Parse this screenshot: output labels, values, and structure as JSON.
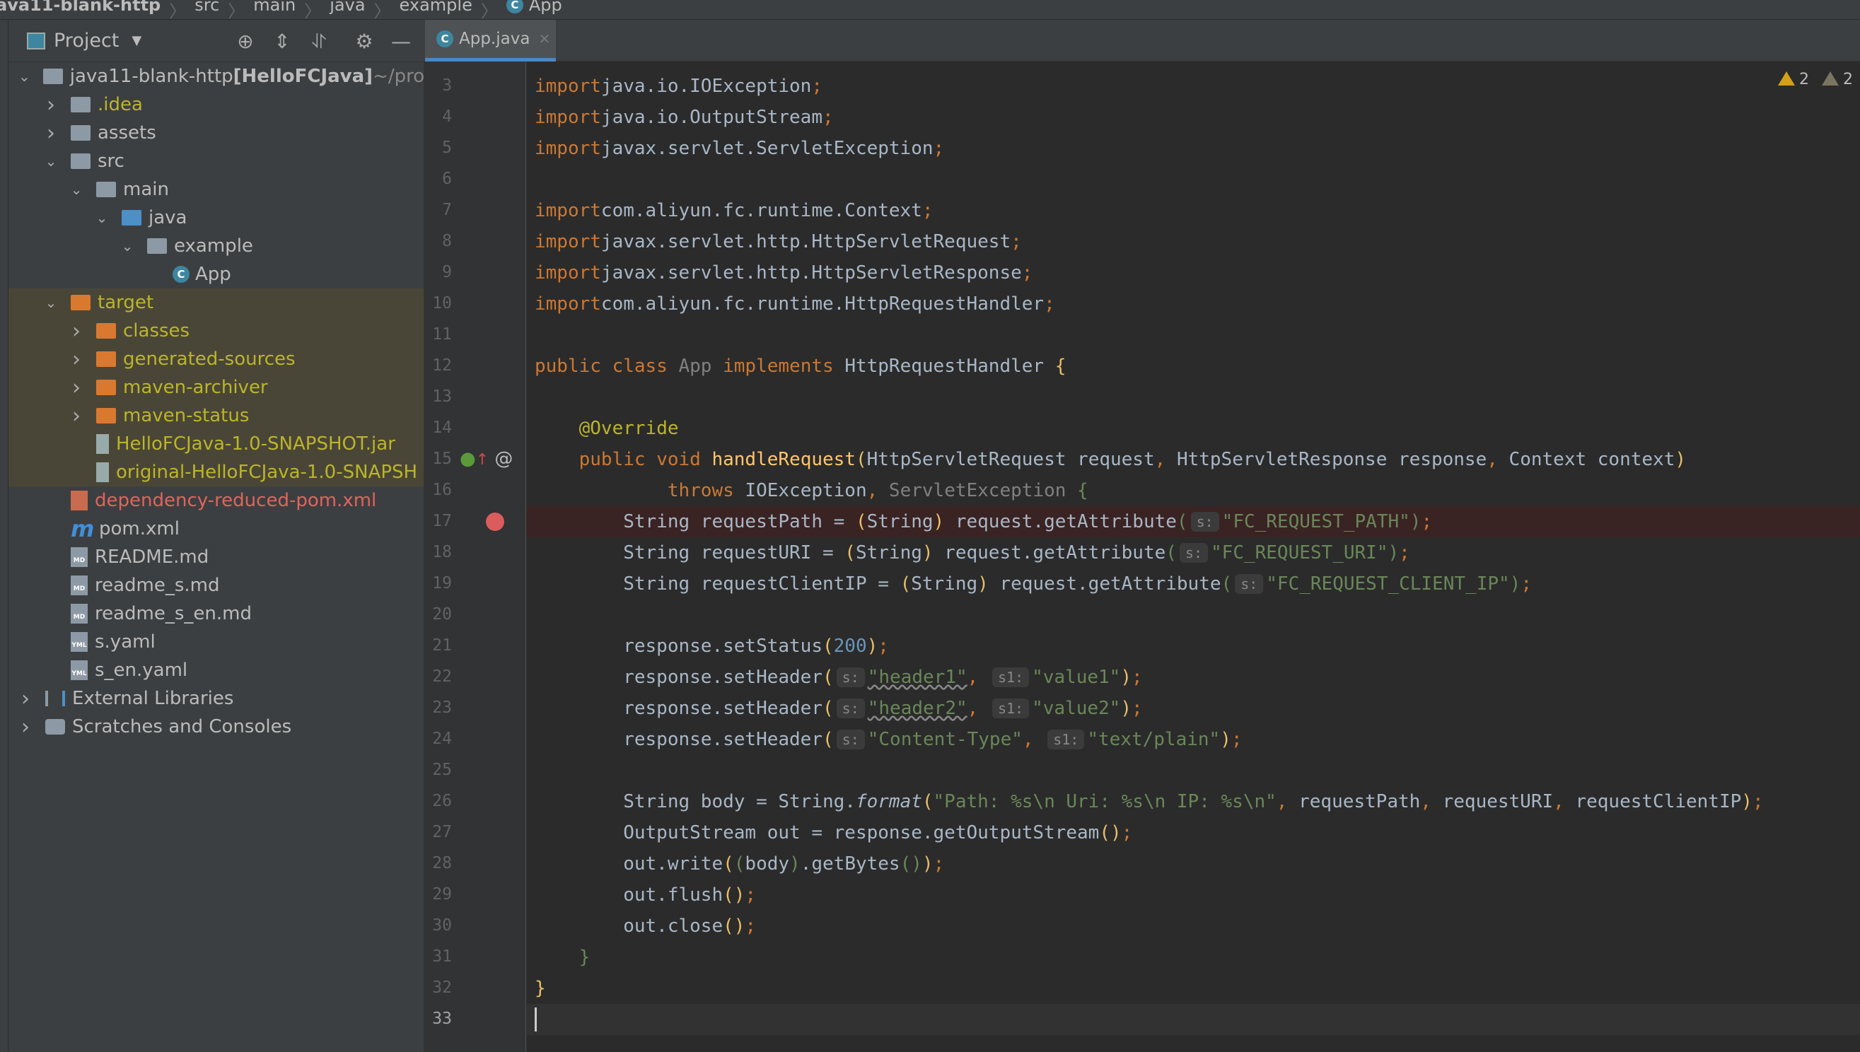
{
  "breadcrumb": [
    "ava11-blank-http",
    "src",
    "main",
    "java",
    "example",
    "App"
  ],
  "project_panel": {
    "title": "Project",
    "toolbar_icons": [
      "locate-icon",
      "expand-all-icon",
      "collapse-all-icon",
      "gear-icon",
      "minimize-icon"
    ]
  },
  "tree": [
    {
      "depth": 0,
      "arrow": "down",
      "icon": "module",
      "label": "java11-blank-http ",
      "bold": "[HelloFCJava]",
      "suffix": " ~/proje"
    },
    {
      "depth": 1,
      "arrow": "right",
      "icon": "folder",
      "label": ".idea",
      "color": "yellow"
    },
    {
      "depth": 1,
      "arrow": "right",
      "icon": "folder",
      "label": "assets"
    },
    {
      "depth": 1,
      "arrow": "down",
      "icon": "folder",
      "label": "src"
    },
    {
      "depth": 2,
      "arrow": "down",
      "icon": "folder",
      "label": "main"
    },
    {
      "depth": 3,
      "arrow": "down",
      "icon": "folder-blue",
      "label": "java"
    },
    {
      "depth": 4,
      "arrow": "down",
      "icon": "package",
      "label": "example"
    },
    {
      "depth": 5,
      "arrow": "",
      "icon": "class",
      "label": "App"
    },
    {
      "depth": 1,
      "arrow": "down",
      "icon": "folder-orange",
      "label": "target",
      "color": "yellow",
      "excluded": true
    },
    {
      "depth": 2,
      "arrow": "right",
      "icon": "folder-orange",
      "label": "classes",
      "color": "yellow",
      "excluded": true
    },
    {
      "depth": 2,
      "arrow": "right",
      "icon": "folder-orange",
      "label": "generated-sources",
      "color": "yellow",
      "excluded": true
    },
    {
      "depth": 2,
      "arrow": "right",
      "icon": "folder-orange",
      "label": "maven-archiver",
      "color": "yellow",
      "excluded": true
    },
    {
      "depth": 2,
      "arrow": "right",
      "icon": "folder-orange",
      "label": "maven-status",
      "color": "yellow",
      "excluded": true
    },
    {
      "depth": 2,
      "arrow": "",
      "icon": "jar",
      "label": "HelloFCJava-1.0-SNAPSHOT.jar",
      "color": "yellow",
      "excluded": true
    },
    {
      "depth": 2,
      "arrow": "",
      "icon": "jar",
      "label": "original-HelloFCJava-1.0-SNAPSH",
      "color": "yellow",
      "excluded": true
    },
    {
      "depth": 1,
      "arrow": "",
      "icon": "xml",
      "label": "dependency-reduced-pom.xml",
      "color": "red"
    },
    {
      "depth": 1,
      "arrow": "",
      "icon": "maven",
      "label": "pom.xml"
    },
    {
      "depth": 1,
      "arrow": "",
      "icon": "md",
      "label": "README.md"
    },
    {
      "depth": 1,
      "arrow": "",
      "icon": "md",
      "label": "readme_s.md"
    },
    {
      "depth": 1,
      "arrow": "",
      "icon": "md",
      "label": "readme_s_en.md"
    },
    {
      "depth": 1,
      "arrow": "",
      "icon": "yaml",
      "label": "s.yaml"
    },
    {
      "depth": 1,
      "arrow": "",
      "icon": "yaml",
      "label": "s_en.yaml"
    },
    {
      "depth": 0,
      "arrow": "right",
      "icon": "libraries",
      "label": "External Libraries"
    },
    {
      "depth": 0,
      "arrow": "right",
      "icon": "scratches",
      "label": "Scratches and Consoles"
    }
  ],
  "editor": {
    "tab": "App.java",
    "warnings": [
      {
        "count": "2",
        "kind": "warning"
      },
      {
        "count": "2",
        "kind": "weak-warning"
      }
    ],
    "breakpoint_line": 17,
    "current_line": 33,
    "lines": [
      {
        "n": "3",
        "t": [
          [
            "kw",
            "import"
          ],
          [
            "",
            "java.io.IOException"
          ],
          [
            "kw",
            ";"
          ]
        ]
      },
      {
        "n": "4",
        "t": [
          [
            "kw",
            "import"
          ],
          [
            "",
            "java.io.OutputStream"
          ],
          [
            "kw",
            ";"
          ]
        ]
      },
      {
        "n": "5",
        "t": [
          [
            "kw",
            "import"
          ],
          [
            "",
            "javax.servlet.ServletException"
          ],
          [
            "kw",
            ";"
          ]
        ]
      },
      {
        "n": "6",
        "t": []
      },
      {
        "n": "7",
        "t": [
          [
            "kw",
            "import"
          ],
          [
            "",
            "com.aliyun.fc.runtime.Context"
          ],
          [
            "kw",
            ";"
          ]
        ]
      },
      {
        "n": "8",
        "t": [
          [
            "kw",
            "import"
          ],
          [
            "",
            "javax.servlet.http.HttpServletRequest"
          ],
          [
            "kw",
            ";"
          ]
        ]
      },
      {
        "n": "9",
        "t": [
          [
            "kw",
            "import"
          ],
          [
            "",
            "javax.servlet.http.HttpServletResponse"
          ],
          [
            "kw",
            ";"
          ]
        ]
      },
      {
        "n": "10",
        "t": [
          [
            "kw",
            "import"
          ],
          [
            "",
            "com.aliyun.fc.runtime.HttpRequestHandler"
          ],
          [
            "kw",
            ";"
          ]
        ]
      },
      {
        "n": "11",
        "t": []
      },
      {
        "n": "12",
        "t": [
          [
            "kw",
            "public class "
          ],
          [
            "gr",
            "App "
          ],
          [
            "kw",
            "implements "
          ],
          [
            "",
            "HttpRequestHandler "
          ],
          [
            "br",
            "{"
          ]
        ]
      },
      {
        "n": "13",
        "t": []
      },
      {
        "n": "14",
        "t": [
          [
            "",
            "    "
          ],
          [
            "an",
            "@Override"
          ]
        ]
      },
      {
        "n": "15",
        "t": [
          [
            "",
            "    "
          ],
          [
            "kw",
            "public void "
          ],
          [
            "fn",
            "handleRequest"
          ],
          [
            "br",
            "("
          ],
          [
            "",
            "HttpServletRequest request"
          ],
          [
            "kw",
            ", "
          ],
          [
            "",
            "HttpServletResponse response"
          ],
          [
            "kw",
            ", "
          ],
          [
            "",
            "Context context"
          ],
          [
            "br",
            ")"
          ]
        ]
      },
      {
        "n": "16",
        "t": [
          [
            "",
            "            "
          ],
          [
            "kw",
            "throws "
          ],
          [
            "",
            "IOException"
          ],
          [
            "kw",
            ", "
          ],
          [
            "gr",
            "ServletException "
          ],
          [
            "st",
            "{"
          ]
        ]
      },
      {
        "n": "17",
        "t": [
          [
            "",
            "        String requestPath = "
          ],
          [
            "br",
            "("
          ],
          [
            "",
            "String"
          ],
          [
            "br",
            ")"
          ],
          [
            "",
            " request.getAttribute"
          ],
          [
            "st",
            "("
          ],
          [
            "hint",
            "s:"
          ],
          [
            "st",
            "\"FC_REQUEST_PATH\""
          ],
          [
            "st",
            ")"
          ],
          [
            "kw",
            ";"
          ]
        ]
      },
      {
        "n": "18",
        "t": [
          [
            "",
            "        String requestURI = "
          ],
          [
            "br",
            "("
          ],
          [
            "",
            "String"
          ],
          [
            "br",
            ")"
          ],
          [
            "",
            " request.getAttribute"
          ],
          [
            "st",
            "("
          ],
          [
            "hint",
            "s:"
          ],
          [
            "st",
            "\"FC_REQUEST_URI\""
          ],
          [
            "st",
            ")"
          ],
          [
            "kw",
            ";"
          ]
        ]
      },
      {
        "n": "19",
        "t": [
          [
            "",
            "        String requestClientIP = "
          ],
          [
            "br",
            "("
          ],
          [
            "",
            "String"
          ],
          [
            "br",
            ")"
          ],
          [
            "",
            " request.getAttribute"
          ],
          [
            "st",
            "("
          ],
          [
            "hint",
            "s:"
          ],
          [
            "st",
            "\"FC_REQUEST_CLIENT_IP\""
          ],
          [
            "st",
            ")"
          ],
          [
            "kw",
            ";"
          ]
        ]
      },
      {
        "n": "20",
        "t": []
      },
      {
        "n": "21",
        "t": [
          [
            "",
            "        response.setStatus"
          ],
          [
            "br",
            "("
          ],
          [
            "num",
            "200"
          ],
          [
            "br",
            ")"
          ],
          [
            "kw",
            ";"
          ]
        ]
      },
      {
        "n": "22",
        "t": [
          [
            "",
            "        response.setHeader"
          ],
          [
            "br",
            "("
          ],
          [
            "hint",
            "s:"
          ],
          [
            "st wv",
            "\"header1\""
          ],
          [
            "kw",
            ", "
          ],
          [
            "hint",
            "s1:"
          ],
          [
            "st",
            "\"value1\""
          ],
          [
            "br",
            ")"
          ],
          [
            "kw",
            ";"
          ]
        ]
      },
      {
        "n": "23",
        "t": [
          [
            "",
            "        response.setHeader"
          ],
          [
            "br",
            "("
          ],
          [
            "hint",
            "s:"
          ],
          [
            "st wv",
            "\"header2\""
          ],
          [
            "kw",
            ", "
          ],
          [
            "hint",
            "s1:"
          ],
          [
            "st",
            "\"value2\""
          ],
          [
            "br",
            ")"
          ],
          [
            "kw",
            ";"
          ]
        ]
      },
      {
        "n": "24",
        "t": [
          [
            "",
            "        response.setHeader"
          ],
          [
            "br",
            "("
          ],
          [
            "hint",
            "s:"
          ],
          [
            "st",
            "\"Content-Type\""
          ],
          [
            "kw",
            ", "
          ],
          [
            "hint",
            "s1:"
          ],
          [
            "st",
            "\"text/plain\""
          ],
          [
            "br",
            ")"
          ],
          [
            "kw",
            ";"
          ]
        ]
      },
      {
        "n": "25",
        "t": []
      },
      {
        "n": "26",
        "t": [
          [
            "",
            "        String body = String."
          ],
          [
            "it",
            "format"
          ],
          [
            "br",
            "("
          ],
          [
            "st",
            "\"Path: %s\\n Uri: %s\\n IP: %s\\n\""
          ],
          [
            "kw",
            ", "
          ],
          [
            "",
            "requestPath"
          ],
          [
            "kw",
            ", "
          ],
          [
            "",
            "requestURI"
          ],
          [
            "kw",
            ", "
          ],
          [
            "",
            "requestClientIP"
          ],
          [
            "br",
            ")"
          ],
          [
            "kw",
            ";"
          ]
        ]
      },
      {
        "n": "27",
        "t": [
          [
            "",
            "        OutputStream out = response.getOutputStream"
          ],
          [
            "br",
            "()"
          ],
          [
            "kw",
            ";"
          ]
        ]
      },
      {
        "n": "28",
        "t": [
          [
            "",
            "        out.write"
          ],
          [
            "br",
            "("
          ],
          [
            "st",
            "("
          ],
          [
            "",
            "body"
          ],
          [
            "st",
            ")"
          ],
          [
            "",
            ".getBytes"
          ],
          [
            "st",
            "()"
          ],
          [
            "br",
            ")"
          ],
          [
            "kw",
            ";"
          ]
        ]
      },
      {
        "n": "29",
        "t": [
          [
            "",
            "        out.flush"
          ],
          [
            "br",
            "()"
          ],
          [
            "kw",
            ";"
          ]
        ]
      },
      {
        "n": "30",
        "t": [
          [
            "",
            "        out.close"
          ],
          [
            "br",
            "()"
          ],
          [
            "kw",
            ";"
          ]
        ]
      },
      {
        "n": "31",
        "t": [
          [
            "",
            "    "
          ],
          [
            "st",
            "}"
          ]
        ]
      },
      {
        "n": "32",
        "t": [
          [
            "br",
            "}"
          ]
        ]
      },
      {
        "n": "33",
        "t": []
      }
    ]
  }
}
